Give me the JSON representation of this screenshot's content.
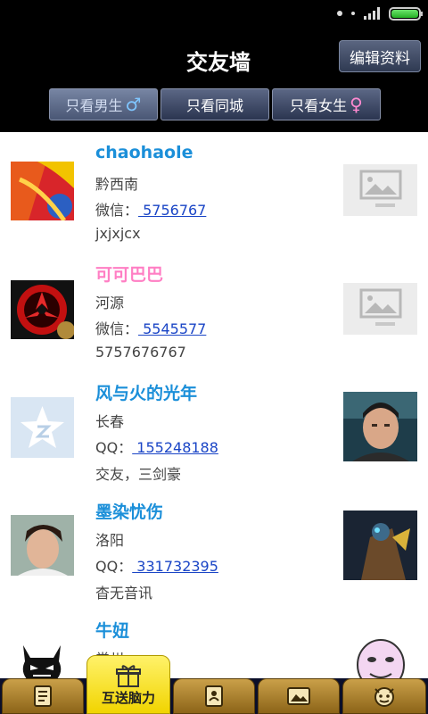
{
  "header": {
    "title": "交友墙",
    "edit_label": "编辑资料",
    "filters": [
      {
        "label": "只看男生",
        "symbol": "♂"
      },
      {
        "label": "只看同城",
        "symbol": ""
      },
      {
        "label": "只看女生",
        "symbol": "♀"
      }
    ]
  },
  "users": [
    {
      "name": "chaohaole",
      "location": "黔西南",
      "contact_label": "微信：",
      "contact_value": " 5756767",
      "note": "jxjxjcx"
    },
    {
      "name": "可可巴巴",
      "location": "河源",
      "contact_label": "微信：",
      "contact_value": " 5545577",
      "note": "5757676767"
    },
    {
      "name": "风与火的光年",
      "location": "长春",
      "contact_label": "QQ：",
      "contact_value": " 155248188",
      "note": "交友，三剑豪"
    },
    {
      "name": "墨染忧伤",
      "location": "洛阳",
      "contact_label": "QQ：",
      "contact_value": " 331732395",
      "note": "杳无音讯"
    },
    {
      "name": "牛妞",
      "location": "常州",
      "contact_label": "",
      "contact_value": "",
      "note": ""
    }
  ],
  "tabs": {
    "active_label": "互送脑力"
  },
  "colors": {
    "name_blue": "#1b8fd9",
    "name_pink": "#ff7fc4",
    "link": "#1a45c6",
    "tab_gold": "#caa049",
    "tab_active": "#f1d400"
  }
}
